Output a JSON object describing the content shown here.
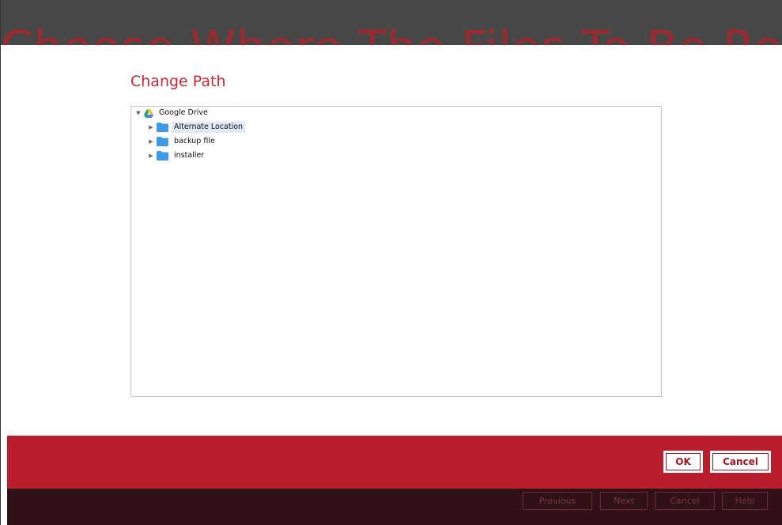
{
  "background": {
    "title": "Choose Where The Files To Be Restored",
    "bar_color": "#474747"
  },
  "dialog": {
    "title": "Change Path",
    "title_color": "#c5283a",
    "tree": {
      "root": {
        "label": "Google Drive",
        "icon": "google-drive-icon",
        "expanded": true
      },
      "children": [
        {
          "label": "Alternate Location",
          "icon": "folder-icon",
          "selected": true
        },
        {
          "label": "backup file",
          "icon": "folder-icon",
          "selected": false
        },
        {
          "label": "installer",
          "icon": "folder-icon",
          "selected": false
        }
      ]
    },
    "buttons": {
      "ok": "OK",
      "cancel": "Cancel"
    },
    "bar_color": "#ba1d2b"
  },
  "wizard_footer": {
    "previous": "Previous",
    "next": "Next",
    "cancel": "Cancel",
    "help": "Help"
  },
  "colors": {
    "folder": "#3d9ae8",
    "accent_red": "#ba1d2b",
    "footer_dark": "#301216"
  }
}
